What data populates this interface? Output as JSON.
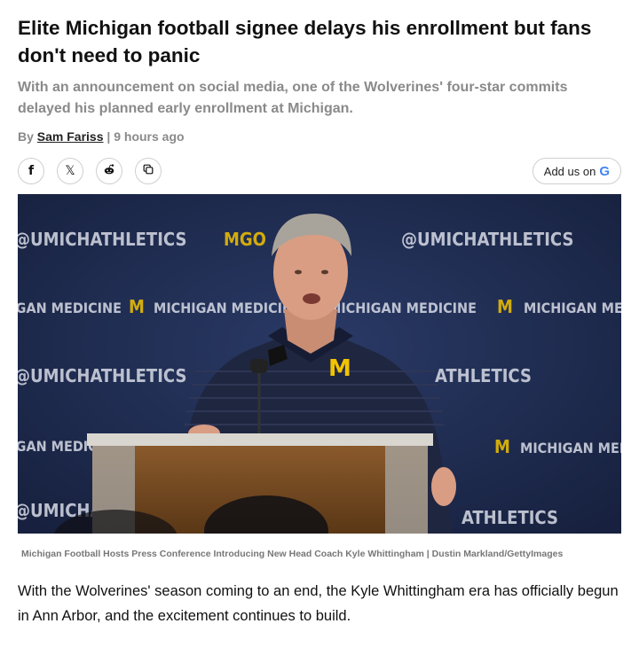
{
  "article": {
    "headline": "Elite Michigan football signee delays his enrollment but fans don't need to panic",
    "dek": "With an announcement on social media, one of the Wolverines' four-star commits delayed his planned early enrollment at Michigan.",
    "byline": {
      "prefix": "By",
      "author": "Sam Fariss",
      "separator": "|",
      "time": "9 hours ago"
    },
    "share": {
      "facebook_glyph": "f",
      "x_glyph": "𝕏"
    },
    "google_button": {
      "label": "Add us on",
      "logo_letter": "G"
    },
    "hero_image": {
      "backdrop_texts": [
        "@UMICHATHLETICS",
        "MGO",
        "MICHIGAN MEDICINE",
        "M",
        "ATHLETICS"
      ]
    },
    "caption": "Michigan Football Hosts Press Conference Introducing New Head Coach Kyle Whittingham | Dustin Markland/GettyImages",
    "body": "With the Wolverines' season coming to an end, the Kyle Whittingham era has officially begun in Ann Arbor, and the excitement continues to build."
  },
  "colors": {
    "backdrop_navy": "#1d2a4e",
    "maize": "#f2c300",
    "muted_text": "#8a8a8a"
  },
  "icons": [
    "facebook-icon",
    "x-icon",
    "reddit-icon",
    "copy-link-icon",
    "google-logo-icon"
  ]
}
